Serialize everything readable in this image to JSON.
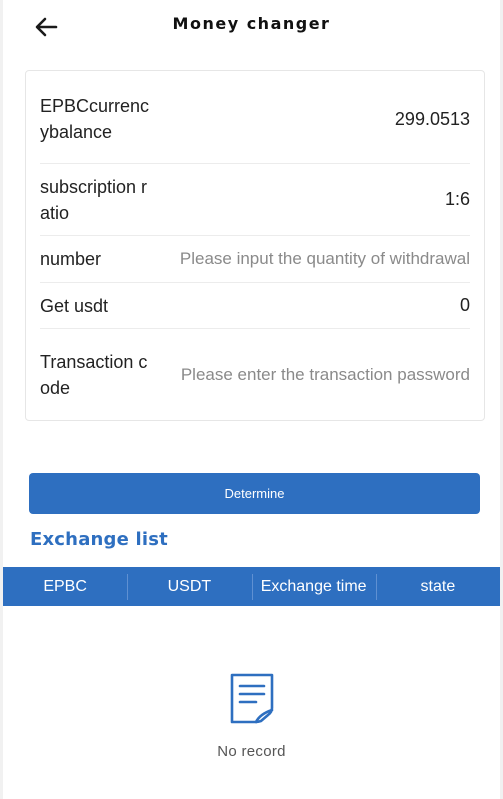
{
  "header": {
    "title": "Money changer",
    "back_icon": "arrow-left-icon"
  },
  "form": {
    "balance_label": "EPBCcurrencybalance",
    "balance_value": "299.0513",
    "ratio_label": "subscription ratio",
    "ratio_value": "1:6",
    "number_label": "number",
    "number_placeholder": "Please input the quantity of withdrawal",
    "number_value": "",
    "get_label": "Get usdt",
    "get_value": "0",
    "code_label": "Transaction code",
    "code_placeholder": "Please enter the transaction password",
    "code_value": ""
  },
  "actions": {
    "determine_label": "Determine"
  },
  "exchange_list": {
    "title": "Exchange list",
    "columns": [
      "EPBC",
      "USDT",
      "Exchange time",
      "state"
    ],
    "rows": [],
    "empty_text": "No record",
    "empty_icon": "document-icon"
  },
  "colors": {
    "accent": "#2e6fc0",
    "text": "#222222",
    "placeholder": "#8a8a8a"
  }
}
